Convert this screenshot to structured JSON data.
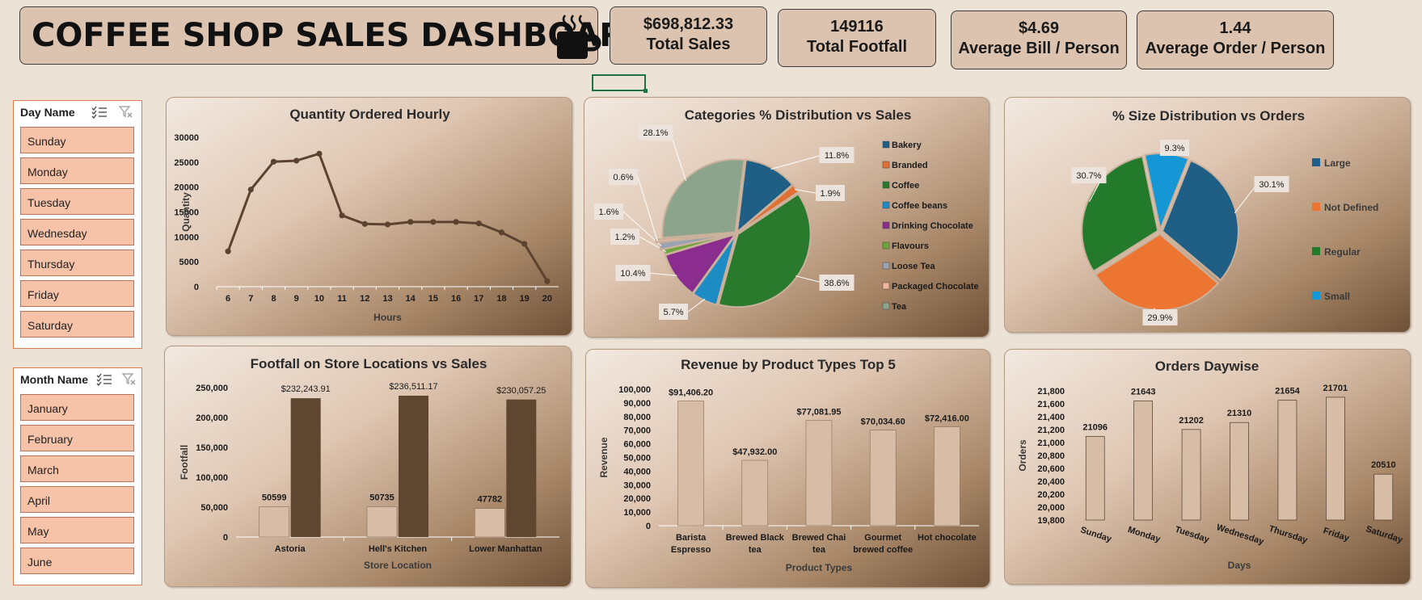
{
  "header": {
    "title": "COFFEE SHOP SALES DASHBOARD"
  },
  "kpis": [
    {
      "value": "$698,812.33",
      "label": "Total Sales"
    },
    {
      "value": "149116",
      "label": "Total Footfall"
    },
    {
      "value": "$4.69",
      "label": "Average Bill / Person"
    },
    {
      "value": "1.44",
      "label": "Average Order / Person"
    }
  ],
  "slicers": {
    "day": {
      "header": "Day Name",
      "items": [
        "Sunday",
        "Monday",
        "Tuesday",
        "Wednesday",
        "Thursday",
        "Friday",
        "Saturday"
      ]
    },
    "month": {
      "header": "Month Name",
      "items": [
        "January",
        "February",
        "March",
        "April",
        "May",
        "June"
      ]
    }
  },
  "chart_data": [
    {
      "type": "line",
      "title": "Quantity Ordered Hourly",
      "xlabel": "Hours",
      "ylabel": "Quantity",
      "x": [
        6,
        7,
        8,
        9,
        10,
        11,
        12,
        13,
        14,
        15,
        16,
        17,
        18,
        19,
        20
      ],
      "values": [
        7100,
        19500,
        25100,
        25300,
        26700,
        14300,
        12600,
        12500,
        13000,
        13000,
        13000,
        12700,
        10900,
        8600,
        1100
      ],
      "ylim": [
        0,
        30000
      ],
      "yticks": [
        "0",
        "5000",
        "10000",
        "15000",
        "20000",
        "25000",
        "30000"
      ],
      "color": "#5c4330"
    },
    {
      "type": "pie",
      "title": "Categories % Distribution vs Sales",
      "slices": [
        {
          "label": "Bakery",
          "value": 11.8,
          "text": "11.8%",
          "color": "#1f5f86"
        },
        {
          "label": "Branded",
          "value": 1.9,
          "text": "1.9%",
          "color": "#e07033"
        },
        {
          "label": "Coffee",
          "value": 38.6,
          "text": "38.6%",
          "color": "#2a7a2e"
        },
        {
          "label": "Coffee beans",
          "value": 5.7,
          "text": "5.7%",
          "color": "#1d8bc4"
        },
        {
          "label": "Drinking Chocolate",
          "value": 10.4,
          "text": "10.4%",
          "color": "#8b2d8f"
        },
        {
          "label": "Flavours",
          "value": 1.2,
          "text": "1.2%",
          "color": "#6ca63a"
        },
        {
          "label": "Loose Tea",
          "value": 1.6,
          "text": "1.6%",
          "color": "#9aa3b1"
        },
        {
          "label": "Packaged Chocolate",
          "value": 0.6,
          "text": "0.6%",
          "color": "#f0b49a"
        },
        {
          "label": "Tea",
          "value": 28.1,
          "text": "28.1%",
          "color": "#8ca38c"
        }
      ]
    },
    {
      "type": "pie",
      "title": "% Size Distribution vs Orders",
      "slices": [
        {
          "label": "Large",
          "value": 30.1,
          "text": "30.1%",
          "color": "#1f5f86"
        },
        {
          "label": "Not Defined",
          "value": 29.9,
          "text": "29.9%",
          "color": "#ed7532"
        },
        {
          "label": "Regular",
          "value": 30.7,
          "text": "30.7%",
          "color": "#237a2a"
        },
        {
          "label": "Small",
          "value": 9.3,
          "text": "9.3%",
          "color": "#1597d6"
        }
      ]
    },
    {
      "type": "bar",
      "title": "Footfall on Store Locations vs Sales",
      "xlabel": "Store Location",
      "ylabel": "Footfall",
      "categories": [
        "Astoria",
        "Hell's Kitchen",
        "Lower Manhattan"
      ],
      "series": [
        {
          "values": [
            50599,
            50735,
            47782
          ],
          "labels": [
            "50599",
            "50735",
            "47782"
          ],
          "color": "#d8bda6"
        },
        {
          "values": [
            232243.91,
            236511.17,
            230057.25
          ],
          "labels": [
            "$232,243.91",
            "$236,511.17",
            "$230,057.25"
          ],
          "color": "#5e4631"
        }
      ],
      "ylim": [
        0,
        250000
      ],
      "yticks": [
        "0",
        "50,000",
        "100,000",
        "150,000",
        "200,000",
        "250,000"
      ]
    },
    {
      "type": "bar",
      "title": "Revenue by Product Types Top 5",
      "xlabel": "Product Types",
      "ylabel": "Revenue",
      "categories": [
        [
          "Barista",
          "Espresso"
        ],
        [
          "Brewed Black",
          "tea"
        ],
        [
          "Brewed Chai",
          "tea"
        ],
        [
          "Gourmet",
          "brewed coffee"
        ],
        [
          "Hot chocolate"
        ]
      ],
      "values": [
        91406.2,
        47932.0,
        77081.95,
        70034.6,
        72416.0
      ],
      "labels": [
        "$91,406.20",
        "$47,932.00",
        "$77,081.95",
        "$70,034.60",
        "$72,416.00"
      ],
      "ylim": [
        0,
        100000
      ],
      "yticks": [
        "0",
        "10,000",
        "20,000",
        "30,000",
        "40,000",
        "50,000",
        "60,000",
        "70,000",
        "80,000",
        "90,000",
        "100,000"
      ],
      "color": "#d8bda6"
    },
    {
      "type": "bar",
      "title": "Orders Daywise",
      "xlabel": "Days",
      "ylabel": "Orders",
      "categories": [
        "Sunday",
        "Monday",
        "Tuesday",
        "Wednesday",
        "Thursday",
        "Friday",
        "Saturday"
      ],
      "values": [
        21096,
        21643,
        21202,
        21310,
        21654,
        21701,
        20510
      ],
      "labels": [
        "21096",
        "21643",
        "21202",
        "21310",
        "21654",
        "21701",
        "20510"
      ],
      "ylim": [
        19800,
        21800
      ],
      "yticks": [
        "19,800",
        "20,000",
        "20,200",
        "20,400",
        "20,600",
        "20,800",
        "21,000",
        "21,200",
        "21,400",
        "21,600",
        "21,800"
      ],
      "color": "#d8bda6"
    }
  ]
}
